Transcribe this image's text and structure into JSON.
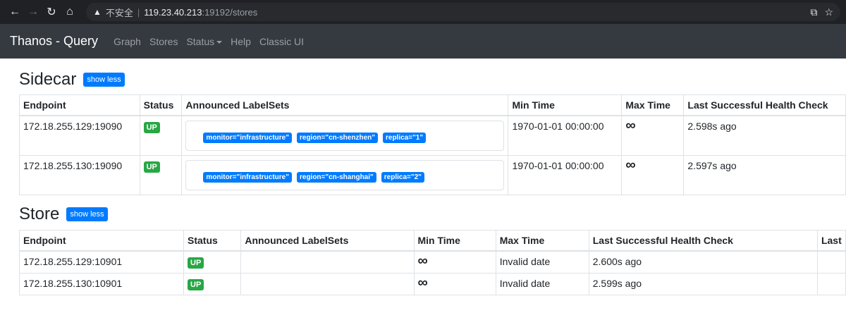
{
  "browser": {
    "security_label": "不安全",
    "url_host": "119.23.40.213",
    "url_rest": ":19192/stores"
  },
  "navbar": {
    "brand": "Thanos - Query",
    "links": [
      "Graph",
      "Stores",
      "Status",
      "Help",
      "Classic UI"
    ]
  },
  "sidecar": {
    "title": "Sidecar",
    "toggle": "show less",
    "headers": [
      "Endpoint",
      "Status",
      "Announced LabelSets",
      "Min Time",
      "Max Time",
      "Last Successful Health Check"
    ],
    "rows": [
      {
        "endpoint": "172.18.255.129:19090",
        "status": "UP",
        "labels": [
          "monitor=\"infrastructure\"",
          "region=\"cn-shenzhen\"",
          "replica=\"1\""
        ],
        "min_time": "1970-01-01 00:00:00",
        "max_time": "∞",
        "health": "2.598s ago"
      },
      {
        "endpoint": "172.18.255.130:19090",
        "status": "UP",
        "labels": [
          "monitor=\"infrastructure\"",
          "region=\"cn-shanghai\"",
          "replica=\"2\""
        ],
        "min_time": "1970-01-01 00:00:00",
        "max_time": "∞",
        "health": "2.597s ago"
      }
    ]
  },
  "store": {
    "title": "Store",
    "toggle": "show less",
    "headers": [
      "Endpoint",
      "Status",
      "Announced LabelSets",
      "Min Time",
      "Max Time",
      "Last Successful Health Check",
      "Last"
    ],
    "rows": [
      {
        "endpoint": "172.18.255.129:10901",
        "status": "UP",
        "min_time": "∞",
        "max_time": "Invalid date",
        "health": "2.600s ago"
      },
      {
        "endpoint": "172.18.255.130:10901",
        "status": "UP",
        "min_time": "∞",
        "max_time": "Invalid date",
        "health": "2.599s ago"
      }
    ]
  }
}
